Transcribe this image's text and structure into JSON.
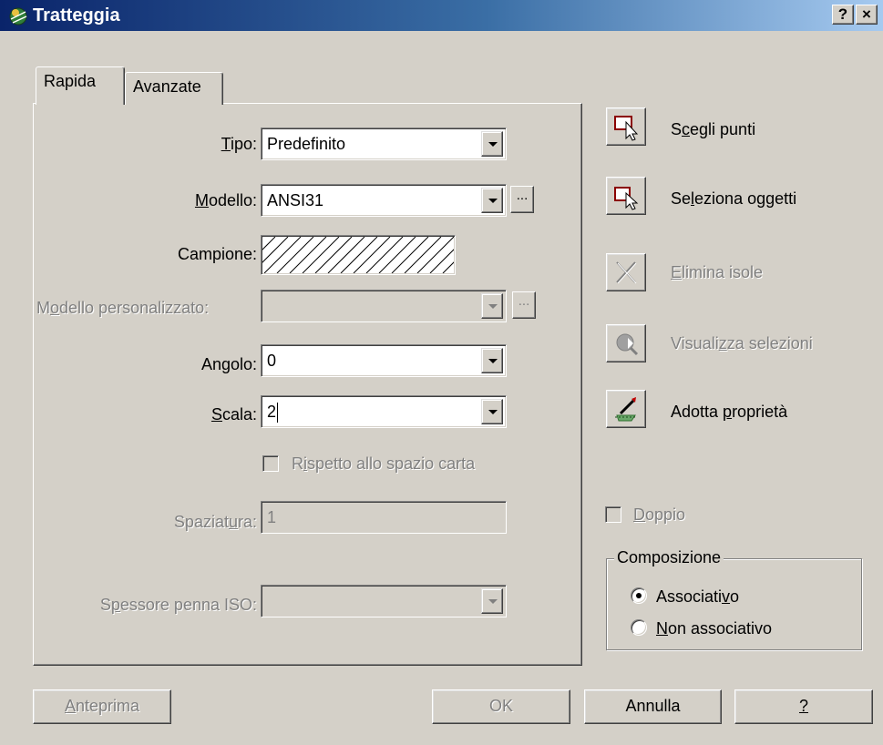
{
  "window": {
    "title": "Tratteggia",
    "help_button": "?",
    "close_button": "×"
  },
  "tabs": [
    {
      "label": "Rapida",
      "active": true
    },
    {
      "label": "Avanzate",
      "active": false
    }
  ],
  "form": {
    "tipo": {
      "label_pre": "",
      "label_u": "T",
      "label_post": "ipo:",
      "value": "Predefinito",
      "enabled": true
    },
    "modello": {
      "label_pre": "",
      "label_u": "M",
      "label_post": "odello:",
      "value": "ANSI31",
      "enabled": true,
      "ellipsis": "..."
    },
    "campione": {
      "label": "Campione:"
    },
    "modello_personalizzato": {
      "label_pre": "M",
      "label_u": "o",
      "label_post": "dello personalizzato:",
      "value": "",
      "enabled": false,
      "ellipsis": "..."
    },
    "angolo": {
      "label": "Angolo:",
      "value": "0",
      "enabled": true
    },
    "scala": {
      "label_pre": "",
      "label_u": "S",
      "label_post": "cala:",
      "value": "2",
      "enabled": true
    },
    "rispetto_spazio_carta": {
      "label_pre": "R",
      "label_u": "i",
      "label_post": "spetto allo spazio carta",
      "checked": false,
      "enabled": false
    },
    "spaziatura": {
      "label_pre": "Spaziat",
      "label_u": "u",
      "label_post": "ra:",
      "value": "1",
      "enabled": false
    },
    "spessore_penna_iso": {
      "label_pre": "S",
      "label_u": "p",
      "label_post": "essore penna ISO:",
      "value": "",
      "enabled": false
    }
  },
  "side": {
    "scegli_punti": {
      "label_pre": "S",
      "label_u": "c",
      "label_post": "egli punti",
      "enabled": true
    },
    "seleziona_oggetti": {
      "label_pre": "Se",
      "label_u": "l",
      "label_post": "eziona oggetti",
      "enabled": true
    },
    "elimina_isole": {
      "label_pre": "",
      "label_u": "E",
      "label_post": "limina isole",
      "enabled": false
    },
    "visualizza_selezioni": {
      "label_pre": "Visuali",
      "label_u": "z",
      "label_post": "za selezioni",
      "enabled": false
    },
    "adotta_proprieta": {
      "label_pre": "Adotta ",
      "label_u": "p",
      "label_post": "roprietà",
      "enabled": true
    },
    "doppio": {
      "label_pre": "",
      "label_u": "D",
      "label_post": "oppio",
      "checked": false,
      "enabled": false
    }
  },
  "composizione": {
    "title": "Composizione",
    "associativo": {
      "label_pre": "Associati",
      "label_u": "v",
      "label_post": "o",
      "selected": true
    },
    "non_associativo": {
      "label_pre": "",
      "label_u": "N",
      "label_post": "on associativo",
      "selected": false
    }
  },
  "buttons": {
    "anteprima": {
      "label_pre": "",
      "label_u": "A",
      "label_post": "nteprima",
      "enabled": false
    },
    "ok": {
      "label": "OK",
      "enabled": false
    },
    "annulla": {
      "label": "Annulla",
      "enabled": true
    },
    "help": {
      "label_u": "?",
      "enabled": true
    }
  },
  "colors": {
    "titlebar_start": "#0a246a",
    "titlebar_end": "#a6caf0",
    "face": "#d4d0c8",
    "disabled_text": "#808080"
  }
}
